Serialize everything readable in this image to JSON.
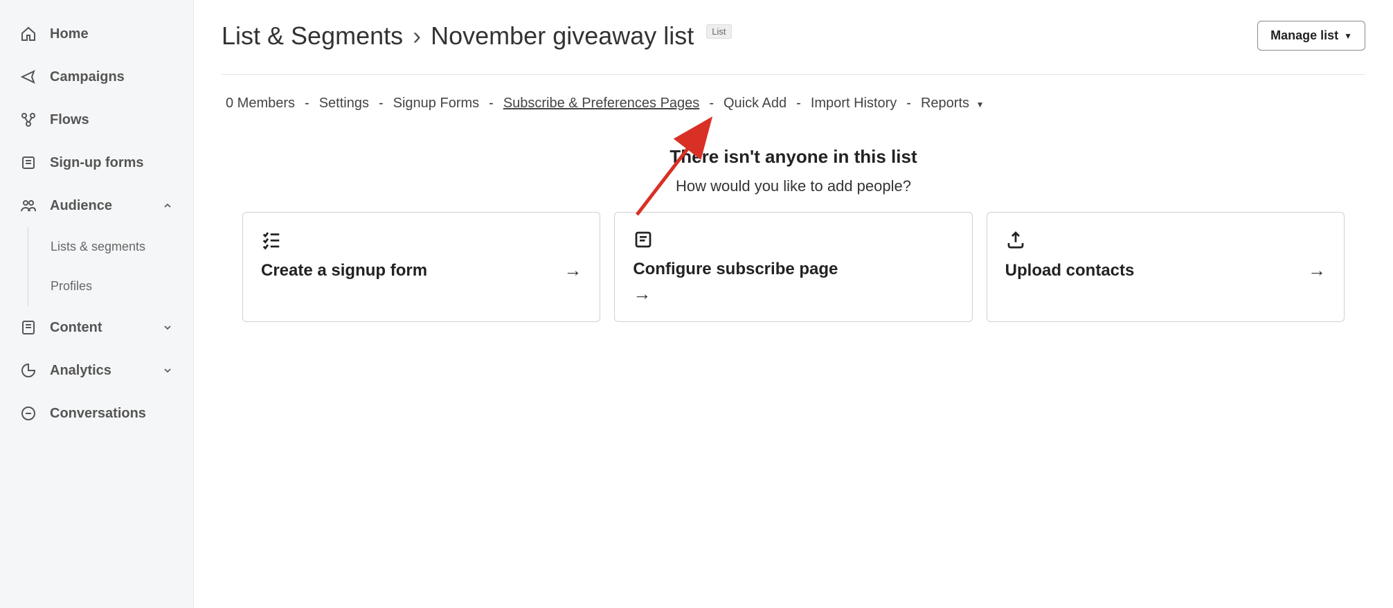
{
  "sidebar": {
    "items": [
      {
        "label": "Home"
      },
      {
        "label": "Campaigns"
      },
      {
        "label": "Flows"
      },
      {
        "label": "Sign-up forms"
      },
      {
        "label": "Audience",
        "expanded": true,
        "children": [
          {
            "label": "Lists & segments"
          },
          {
            "label": "Profiles"
          }
        ]
      },
      {
        "label": "Content"
      },
      {
        "label": "Analytics"
      },
      {
        "label": "Conversations"
      }
    ]
  },
  "breadcrumb": {
    "root": "List & Segments",
    "current": "November giveaway list",
    "badge": "List"
  },
  "manage_button": "Manage list",
  "tabs": {
    "members": "0 Members",
    "settings": "Settings",
    "signup_forms": "Signup Forms",
    "subscribe_prefs": "Subscribe & Preferences Pages",
    "quick_add": "Quick Add",
    "import_history": "Import History",
    "reports": "Reports"
  },
  "empty_state": {
    "heading": "There isn't anyone in this list",
    "subheading": "How would you like to add people?",
    "cards": [
      {
        "title": "Create a signup form"
      },
      {
        "title": "Configure subscribe page"
      },
      {
        "title": "Upload contacts"
      }
    ]
  }
}
